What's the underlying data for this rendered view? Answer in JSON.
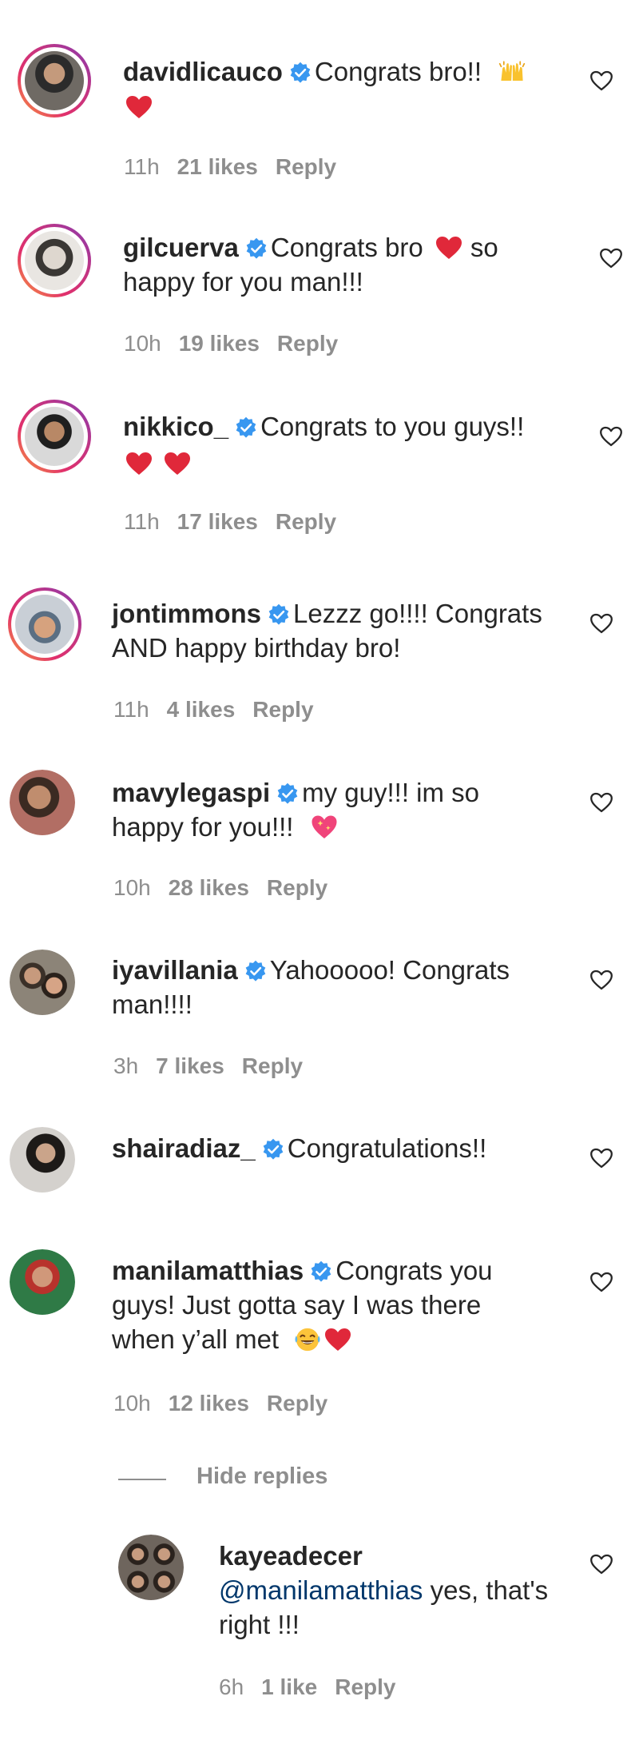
{
  "colors": {
    "heart": "#ed4956",
    "verified": "#3897f0",
    "muted": "#8e8e8e",
    "mention": "#00376b"
  },
  "comments": [
    {
      "username": "davidlicauco",
      "text": "Congrats bro!!",
      "time": "11h",
      "likes": "21 likes",
      "reply": "Reply",
      "emoji": [
        "raising-hands",
        "red-heart"
      ]
    },
    {
      "username": "gilcuerva",
      "text_a": "Congrats bro",
      "text_b": "so",
      "text_c": "happy for you man!!!",
      "time": "10h",
      "likes": "19 likes",
      "reply": "Reply",
      "emoji": [
        "red-heart"
      ]
    },
    {
      "username": "nikkico_",
      "text": "Congrats to you guys!!",
      "time": "11h",
      "likes": "17 likes",
      "reply": "Reply",
      "emoji": [
        "red-heart",
        "red-heart"
      ]
    },
    {
      "username": "jontimmons",
      "text_a": "Lezzz go!!!! Congrats",
      "text_b": "AND happy birthday bro!",
      "time": "11h",
      "likes": "4 likes",
      "reply": "Reply"
    },
    {
      "username": "mavylegaspi",
      "text_a": "my guy!!! im so",
      "text_b": "happy for you!!!",
      "time": "10h",
      "likes": "28 likes",
      "reply": "Reply",
      "emoji": [
        "sparkling-heart"
      ]
    },
    {
      "username": "iyavillania",
      "text_a": "Yahooooo! Congrats",
      "text_b": "man!!!!",
      "time": "3h",
      "likes": "7 likes",
      "reply": "Reply"
    },
    {
      "username": "shairadiaz_",
      "text": "Congratulations!!"
    },
    {
      "username": "manilamatthias",
      "text_a": "Congrats you",
      "text_b": "guys! Just gotta say I was there",
      "text_c": "when y’all met",
      "time": "10h",
      "likes": "12 likes",
      "reply": "Reply",
      "emoji": [
        "tears-of-joy",
        "red-heart"
      ]
    }
  ],
  "hide_replies": "Hide replies",
  "reply_thread": {
    "username": "kayeadecer",
    "mention": "@manilamatthias",
    "text_a": "yes, that's",
    "text_b": "right !!!",
    "time": "6h",
    "likes": "1 like",
    "reply": "Reply"
  }
}
